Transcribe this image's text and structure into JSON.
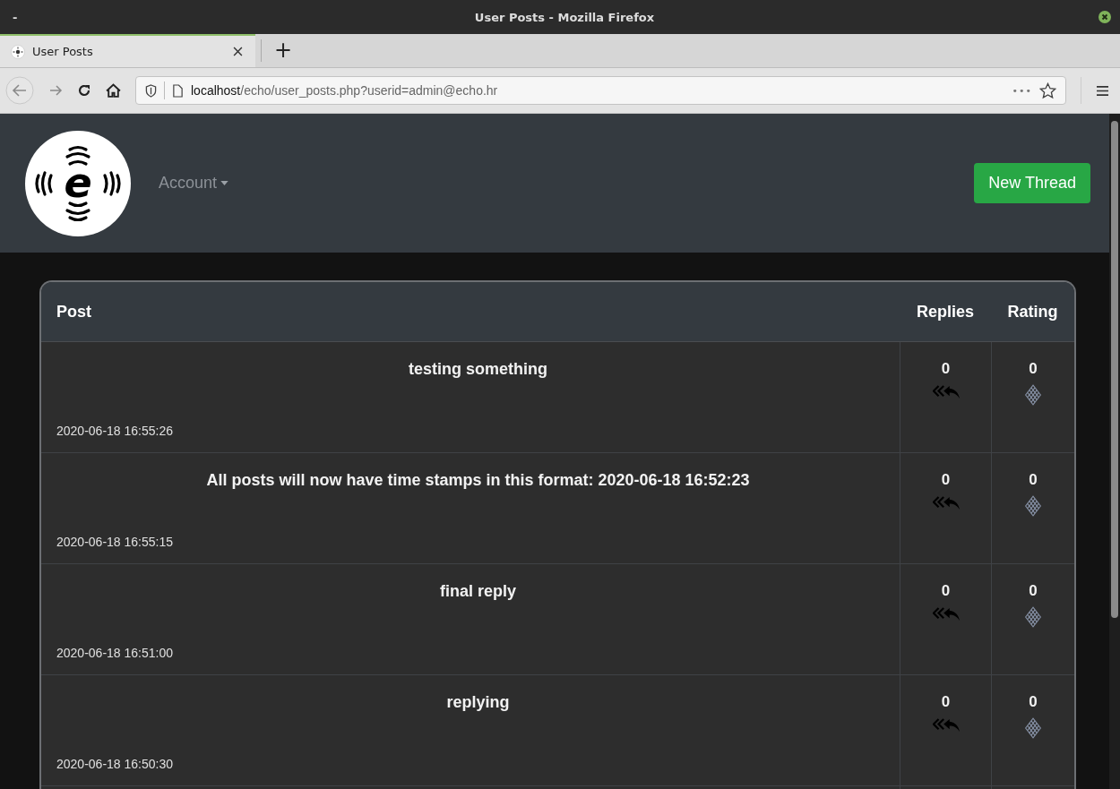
{
  "window": {
    "title": "User Posts - Mozilla Firefox",
    "minimize": "-"
  },
  "tabs": [
    {
      "label": "User Posts",
      "selected": true
    }
  ],
  "new_tab": "+",
  "address_bar": {
    "host": "localhost",
    "path": "/echo/user_posts.php?userid=admin@echo.hr",
    "more": "•••"
  },
  "site": {
    "logo_letter": "e",
    "nav": [
      {
        "label": "Account",
        "dropdown": true
      }
    ],
    "new_thread": "New Thread"
  },
  "table": {
    "columns": [
      "Post",
      "Replies",
      "Rating"
    ],
    "rows": [
      {
        "title": "testing something",
        "timestamp": "2020-06-18 16:55:26",
        "replies": "0",
        "rating": "0"
      },
      {
        "title": "All posts will now have time stamps in this format: 2020-06-18 16:52:23",
        "timestamp": "2020-06-18 16:55:15",
        "replies": "0",
        "rating": "0"
      },
      {
        "title": "final reply",
        "timestamp": "2020-06-18 16:51:00",
        "replies": "0",
        "rating": "0"
      },
      {
        "title": "replying",
        "timestamp": "2020-06-18 16:50:30",
        "replies": "0",
        "rating": "0"
      }
    ]
  }
}
